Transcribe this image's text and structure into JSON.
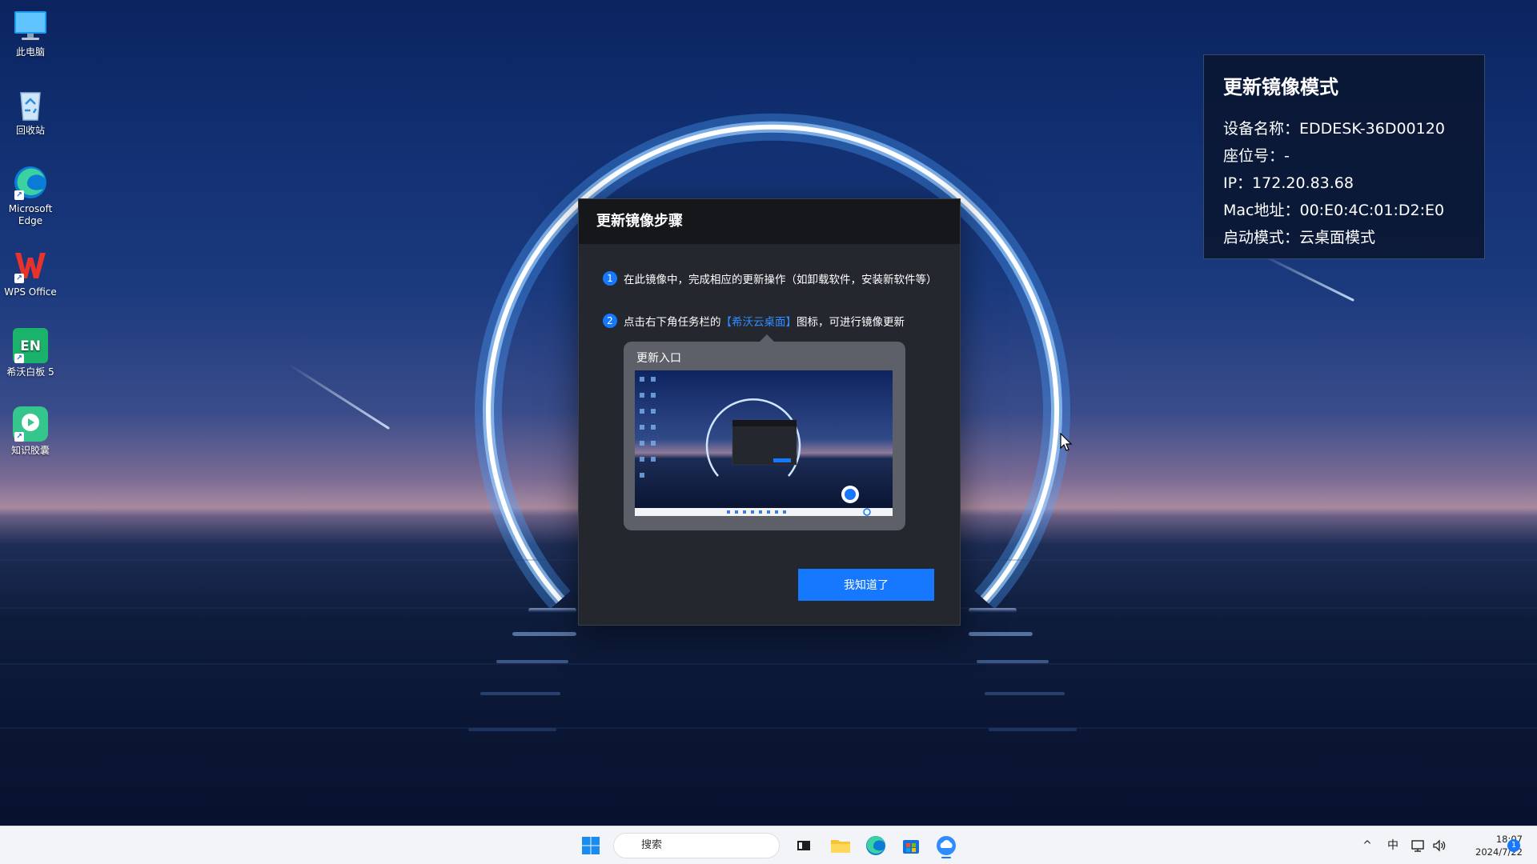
{
  "desktop": {
    "icons": [
      {
        "label": "此电脑",
        "icon": "computer-icon"
      },
      {
        "label": "回收站",
        "icon": "recycle-bin-icon"
      },
      {
        "label": "Microsoft Edge",
        "icon": "edge-icon"
      },
      {
        "label": "WPS Office",
        "icon": "wps-icon"
      },
      {
        "label": "希沃白板 5",
        "icon": "seewo-board-icon"
      },
      {
        "label": "知识胶囊",
        "icon": "knowledge-capsule-icon"
      }
    ]
  },
  "info_panel": {
    "title": "更新镜像模式",
    "device_name": "设备名称：EDDESK-36D00120",
    "seat": "座位号：-",
    "ip": "IP：172.20.83.68",
    "mac": "Mac地址：00:E0:4C:01:D2:E0",
    "boot_mode": "启动模式：云桌面模式"
  },
  "modal": {
    "title": "更新镜像步骤",
    "step1_num": "1",
    "step1_text": "在此镜像中，完成相应的更新操作（如卸载软件，安装新软件等）",
    "step2_num": "2",
    "step2_prefix": "点击右下角任务栏的",
    "step2_link": "【希沃云桌面】",
    "step2_suffix": "图标，可进行镜像更新",
    "preview_title": "更新入口",
    "ok_label": "我知道了"
  },
  "taskbar": {
    "search_placeholder": "搜索",
    "tray_ime": "中",
    "tray_chevron": "^",
    "time": "18:07",
    "date": "2024/7/22",
    "notification_count": "1"
  },
  "colors": {
    "accent": "#1677ff",
    "link": "#2f8cff",
    "modal_bg": "#24272e",
    "modal_header": "#15171b",
    "panel_bg": "#0a1630"
  }
}
